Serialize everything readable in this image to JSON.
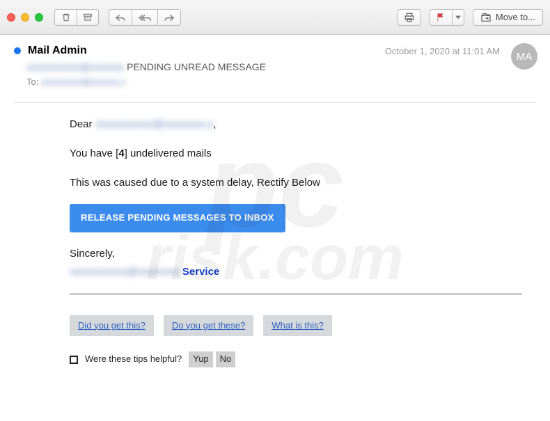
{
  "toolbar": {
    "move_to_label": "Move to...",
    "avatar_initials": "MA"
  },
  "header": {
    "sender": "Mail Admin",
    "subject_suffix": " PENDING UNREAD MESSAGE",
    "to_label": "To: ",
    "date": "October 1, 2020 at 11:01 AM"
  },
  "body": {
    "greeting_prefix": "Dear ",
    "greeting_suffix": ",",
    "line2_a": "You have [",
    "line2_count": "4",
    "line2_b": "] undelivered mails",
    "line3": "This was caused due to a system delay, Rectify Below",
    "button": "RELEASE PENDING MESSAGES TO INBOX",
    "sincerely": "Sincerely,",
    "service_word": "Service"
  },
  "prompts": [
    "Did you get this?",
    "Do you get these?",
    "What is this?"
  ],
  "tips": {
    "question": "Were these tips helpful?",
    "yes": "Yup",
    "no": "No"
  },
  "watermark": {
    "line1": "pc",
    "line2": "risk.com"
  },
  "redacted": {
    "subject_email": "xxxxxxxxxxx@xxxxxxx",
    "to_email": "xxxxxxxxx@xxxxxx.x",
    "dear_email": "xxxxxxxxxxx@xxxxxxxx.x",
    "service_email": "xxxxxxxxxxx@xxxxxxxx"
  }
}
